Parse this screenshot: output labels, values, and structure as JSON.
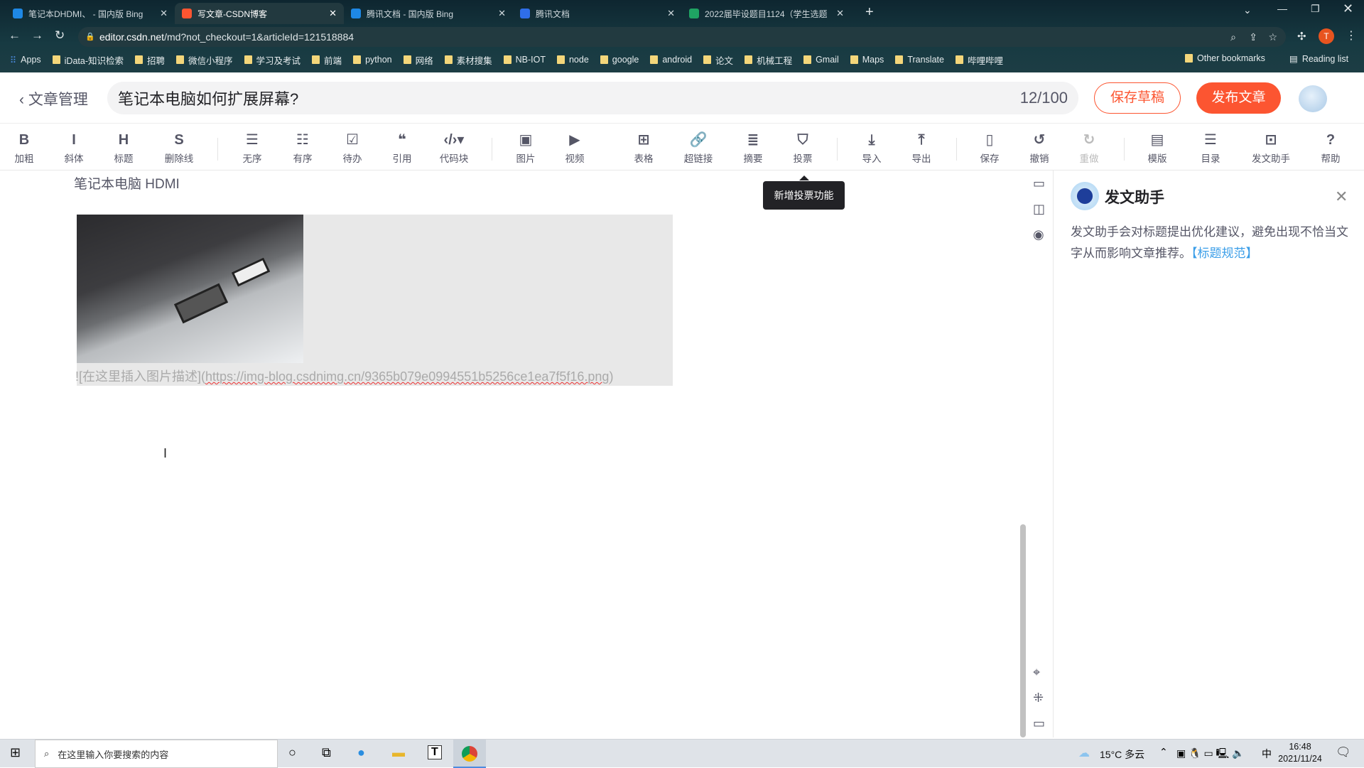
{
  "browser": {
    "tabs": [
      {
        "title": "笔记本DHDMI、 - 国内版 Bing",
        "color": "#1e88e5",
        "active": false
      },
      {
        "title": "写文章-CSDN博客",
        "color": "#fc5531",
        "active": true
      },
      {
        "title": "腾讯文档 - 国内版 Bing",
        "color": "#1e88e5",
        "active": false
      },
      {
        "title": "腾讯文档",
        "color": "#2f6ee8",
        "active": false
      },
      {
        "title": "2022届毕设题目1124（学生选题",
        "color": "#1fa463",
        "active": false
      }
    ],
    "new_tab": "+",
    "url_host": "editor.csdn.net",
    "url_path": "/md?not_checkout=1&articleId=121518884",
    "profile_initial": "T",
    "bookmarks": [
      "Apps",
      "iData-知识检索",
      "招聘",
      "微信小程序",
      "学习及考试",
      "前端",
      "python",
      "网络",
      "素材搜集",
      "NB-IOT",
      "node",
      "google",
      "android",
      "论文",
      "机械工程",
      "Gmail",
      "Maps",
      "Translate",
      "哔哩哔哩"
    ],
    "other_bookmarks": "Other bookmarks",
    "reading_list": "Reading list"
  },
  "header": {
    "back_label": "文章管理",
    "title_value": "笔记本电脑如何扩展屏幕?",
    "title_count": "12/100",
    "save_draft": "保存草稿",
    "publish": "发布文章",
    "accent": "#fc5531"
  },
  "toolbar": {
    "items": [
      {
        "icon": "B",
        "label": "加粗",
        "name": "bold"
      },
      {
        "icon": "I",
        "label": "斜体",
        "name": "italic"
      },
      {
        "icon": "H",
        "label": "标题",
        "name": "heading"
      },
      {
        "icon": "S",
        "label": "删除线",
        "name": "strikethrough"
      },
      {
        "icon": "☰",
        "label": "无序",
        "name": "unordered-list"
      },
      {
        "icon": "☷",
        "label": "有序",
        "name": "ordered-list"
      },
      {
        "icon": "☑",
        "label": "待办",
        "name": "todo"
      },
      {
        "icon": "❝",
        "label": "引用",
        "name": "quote"
      },
      {
        "icon": "‹/›▾",
        "label": "代码块",
        "name": "code-block"
      },
      {
        "icon": "▣",
        "label": "图片",
        "name": "image"
      },
      {
        "icon": "▶",
        "label": "视频",
        "name": "video"
      },
      {
        "icon": "⊞",
        "label": "表格",
        "name": "table"
      },
      {
        "icon": "🔗",
        "label": "超链接",
        "name": "link"
      },
      {
        "icon": "≣",
        "label": "摘要",
        "name": "summary"
      },
      {
        "icon": "⛉",
        "label": "投票",
        "name": "vote"
      },
      {
        "icon": "⤓",
        "label": "导入",
        "name": "import"
      },
      {
        "icon": "⤒",
        "label": "导出",
        "name": "export"
      },
      {
        "icon": "▯",
        "label": "保存",
        "name": "save"
      },
      {
        "icon": "↺",
        "label": "撤销",
        "name": "undo"
      },
      {
        "icon": "↻",
        "label": "重做",
        "name": "redo",
        "disabled": true
      },
      {
        "icon": "▤",
        "label": "模版",
        "name": "template"
      },
      {
        "icon": "☰",
        "label": "目录",
        "name": "toc"
      },
      {
        "icon": "⊡",
        "label": "发文助手",
        "name": "assistant"
      },
      {
        "icon": "?",
        "label": "帮助",
        "name": "help"
      }
    ],
    "tooltip": "新增投票功能"
  },
  "editor": {
    "line1": "笔记本电脑 HDMI",
    "image_alt": "![在这里插入图片描述](",
    "image_url": "https://img-blog.csdnimg.cn/9365b079e0994551b5256ce1ea7f5f16.png",
    "image_close": ")"
  },
  "assistant": {
    "title": "发文助手",
    "body": "发文助手会对标题提出优化建议，避免出现不恰当文字从而影响文章推荐。",
    "link": "【标题规范】",
    "link_color": "#3b9ee8"
  },
  "taskbar": {
    "search_placeholder": "在这里输入你要搜索的内容",
    "weather": "15°C 多云",
    "ime": "中",
    "time": "16:48",
    "date": "2021/11/24"
  }
}
